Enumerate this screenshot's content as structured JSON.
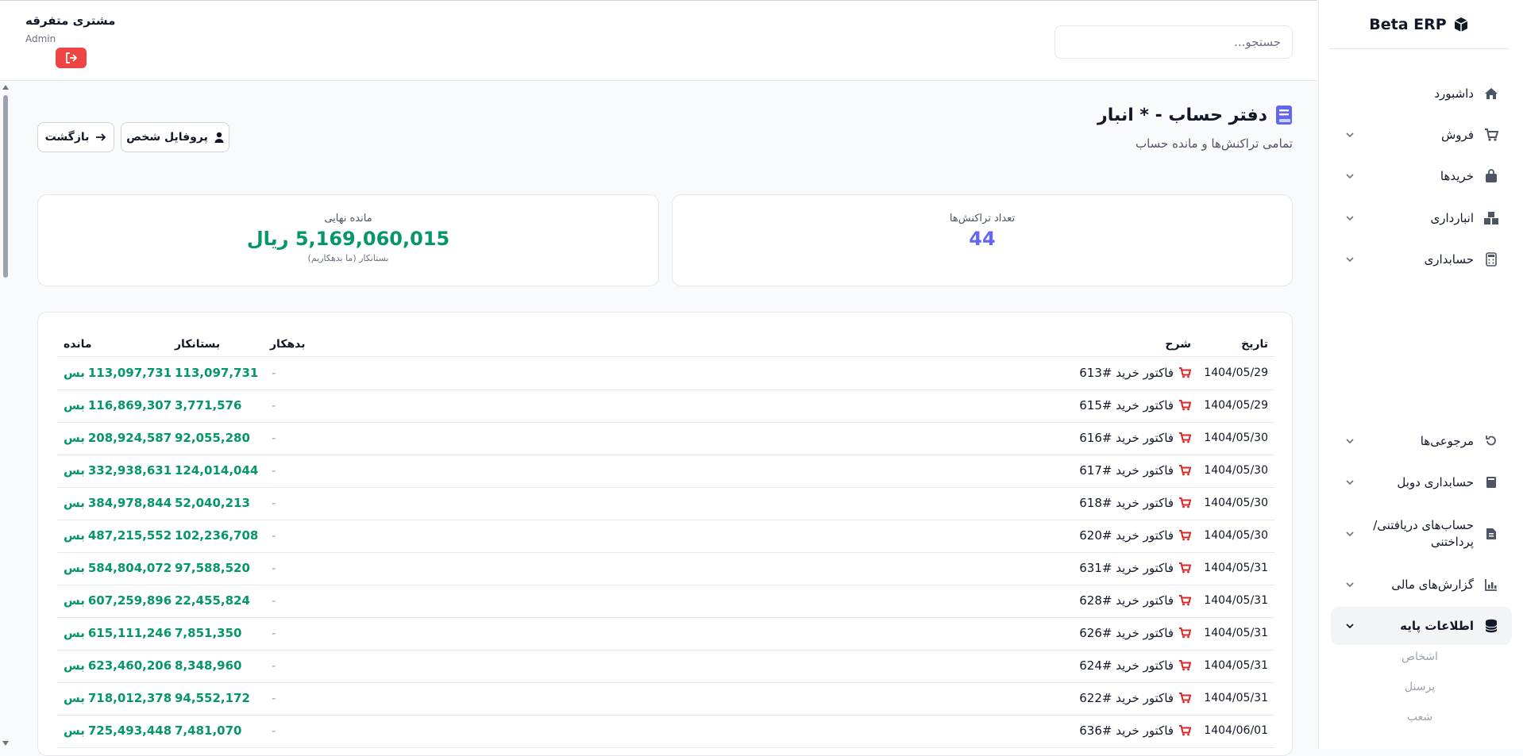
{
  "brand": {
    "name": "Beta ERP"
  },
  "sidebar": {
    "items": [
      {
        "label": "داشبورد",
        "icon": "home-icon",
        "has_chevron": false
      },
      {
        "label": "فروش",
        "icon": "cart-icon",
        "has_chevron": true
      },
      {
        "label": "خریدها",
        "icon": "bag-icon",
        "has_chevron": true
      },
      {
        "label": "انبارداری",
        "icon": "boxes-icon",
        "has_chevron": true
      },
      {
        "label": "حسابداری",
        "icon": "calculator-icon",
        "has_chevron": true
      },
      {
        "label": "مرجوعی‌ها",
        "icon": "undo-icon",
        "has_chevron": true
      },
      {
        "label": "حسابداری دوبل",
        "icon": "book-icon",
        "has_chevron": true
      },
      {
        "label": "حساب‌های دریافتنی/پرداختنی",
        "icon": "invoice-icon",
        "has_chevron": true
      },
      {
        "label": "گزارش‌های مالی",
        "icon": "chart-icon",
        "has_chevron": true
      },
      {
        "label": "اطلاعات پایه",
        "icon": "database-icon",
        "has_chevron": true,
        "active": true
      }
    ],
    "sub_items": [
      "اشخاص",
      "پرسنل",
      "شعب"
    ]
  },
  "header": {
    "search_placeholder": "جستجو...",
    "user_name": "مشتری متفرقه",
    "user_role": "Admin"
  },
  "page": {
    "title": "دفتر حساب - * انبار",
    "subtitle": "تمامی تراکنش‌ها و مانده حساب",
    "profile_button": "پروفایل شخص",
    "back_button": "بازگشت"
  },
  "cards": {
    "count_label": "تعداد تراکنش‌ها",
    "count_value": "44",
    "balance_label": "مانده نهایی",
    "balance_value": "5,169,060,015 ریال",
    "balance_note": "بستانکار (ما بدهکاریم)"
  },
  "table": {
    "headers": {
      "date": "تاریخ",
      "desc": "شرح",
      "debit": "بدهکار",
      "credit": "بستانکار",
      "balance": "مانده"
    },
    "rows": [
      {
        "date": "1404/05/29",
        "desc": "فاکتور خرید #613",
        "debit": "-",
        "credit": "113,097,731",
        "balance": "113,097,731",
        "balance_type": "بس"
      },
      {
        "date": "1404/05/29",
        "desc": "فاکتور خرید #615",
        "debit": "-",
        "credit": "3,771,576",
        "balance": "116,869,307",
        "balance_type": "بس"
      },
      {
        "date": "1404/05/30",
        "desc": "فاکتور خرید #616",
        "debit": "-",
        "credit": "92,055,280",
        "balance": "208,924,587",
        "balance_type": "بس"
      },
      {
        "date": "1404/05/30",
        "desc": "فاکتور خرید #617",
        "debit": "-",
        "credit": "124,014,044",
        "balance": "332,938,631",
        "balance_type": "بس"
      },
      {
        "date": "1404/05/30",
        "desc": "فاکتور خرید #618",
        "debit": "-",
        "credit": "52,040,213",
        "balance": "384,978,844",
        "balance_type": "بس"
      },
      {
        "date": "1404/05/30",
        "desc": "فاکتور خرید #620",
        "debit": "-",
        "credit": "102,236,708",
        "balance": "487,215,552",
        "balance_type": "بس"
      },
      {
        "date": "1404/05/31",
        "desc": "فاکتور خرید #631",
        "debit": "-",
        "credit": "97,588,520",
        "balance": "584,804,072",
        "balance_type": "بس"
      },
      {
        "date": "1404/05/31",
        "desc": "فاکتور خرید #628",
        "debit": "-",
        "credit": "22,455,824",
        "balance": "607,259,896",
        "balance_type": "بس"
      },
      {
        "date": "1404/05/31",
        "desc": "فاکتور خرید #626",
        "debit": "-",
        "credit": "7,851,350",
        "balance": "615,111,246",
        "balance_type": "بس"
      },
      {
        "date": "1404/05/31",
        "desc": "فاکتور خرید #624",
        "debit": "-",
        "credit": "8,348,960",
        "balance": "623,460,206",
        "balance_type": "بس"
      },
      {
        "date": "1404/05/31",
        "desc": "فاکتور خرید #622",
        "debit": "-",
        "credit": "94,552,172",
        "balance": "718,012,378",
        "balance_type": "بس"
      },
      {
        "date": "1404/06/01",
        "desc": "فاکتور خرید #636",
        "debit": "-",
        "credit": "7,481,070",
        "balance": "725,493,448",
        "balance_type": "بس"
      }
    ]
  },
  "colors": {
    "accent": "#6366f1",
    "positive": "#059669",
    "danger": "#ef4444",
    "cart": "#dc2626"
  }
}
